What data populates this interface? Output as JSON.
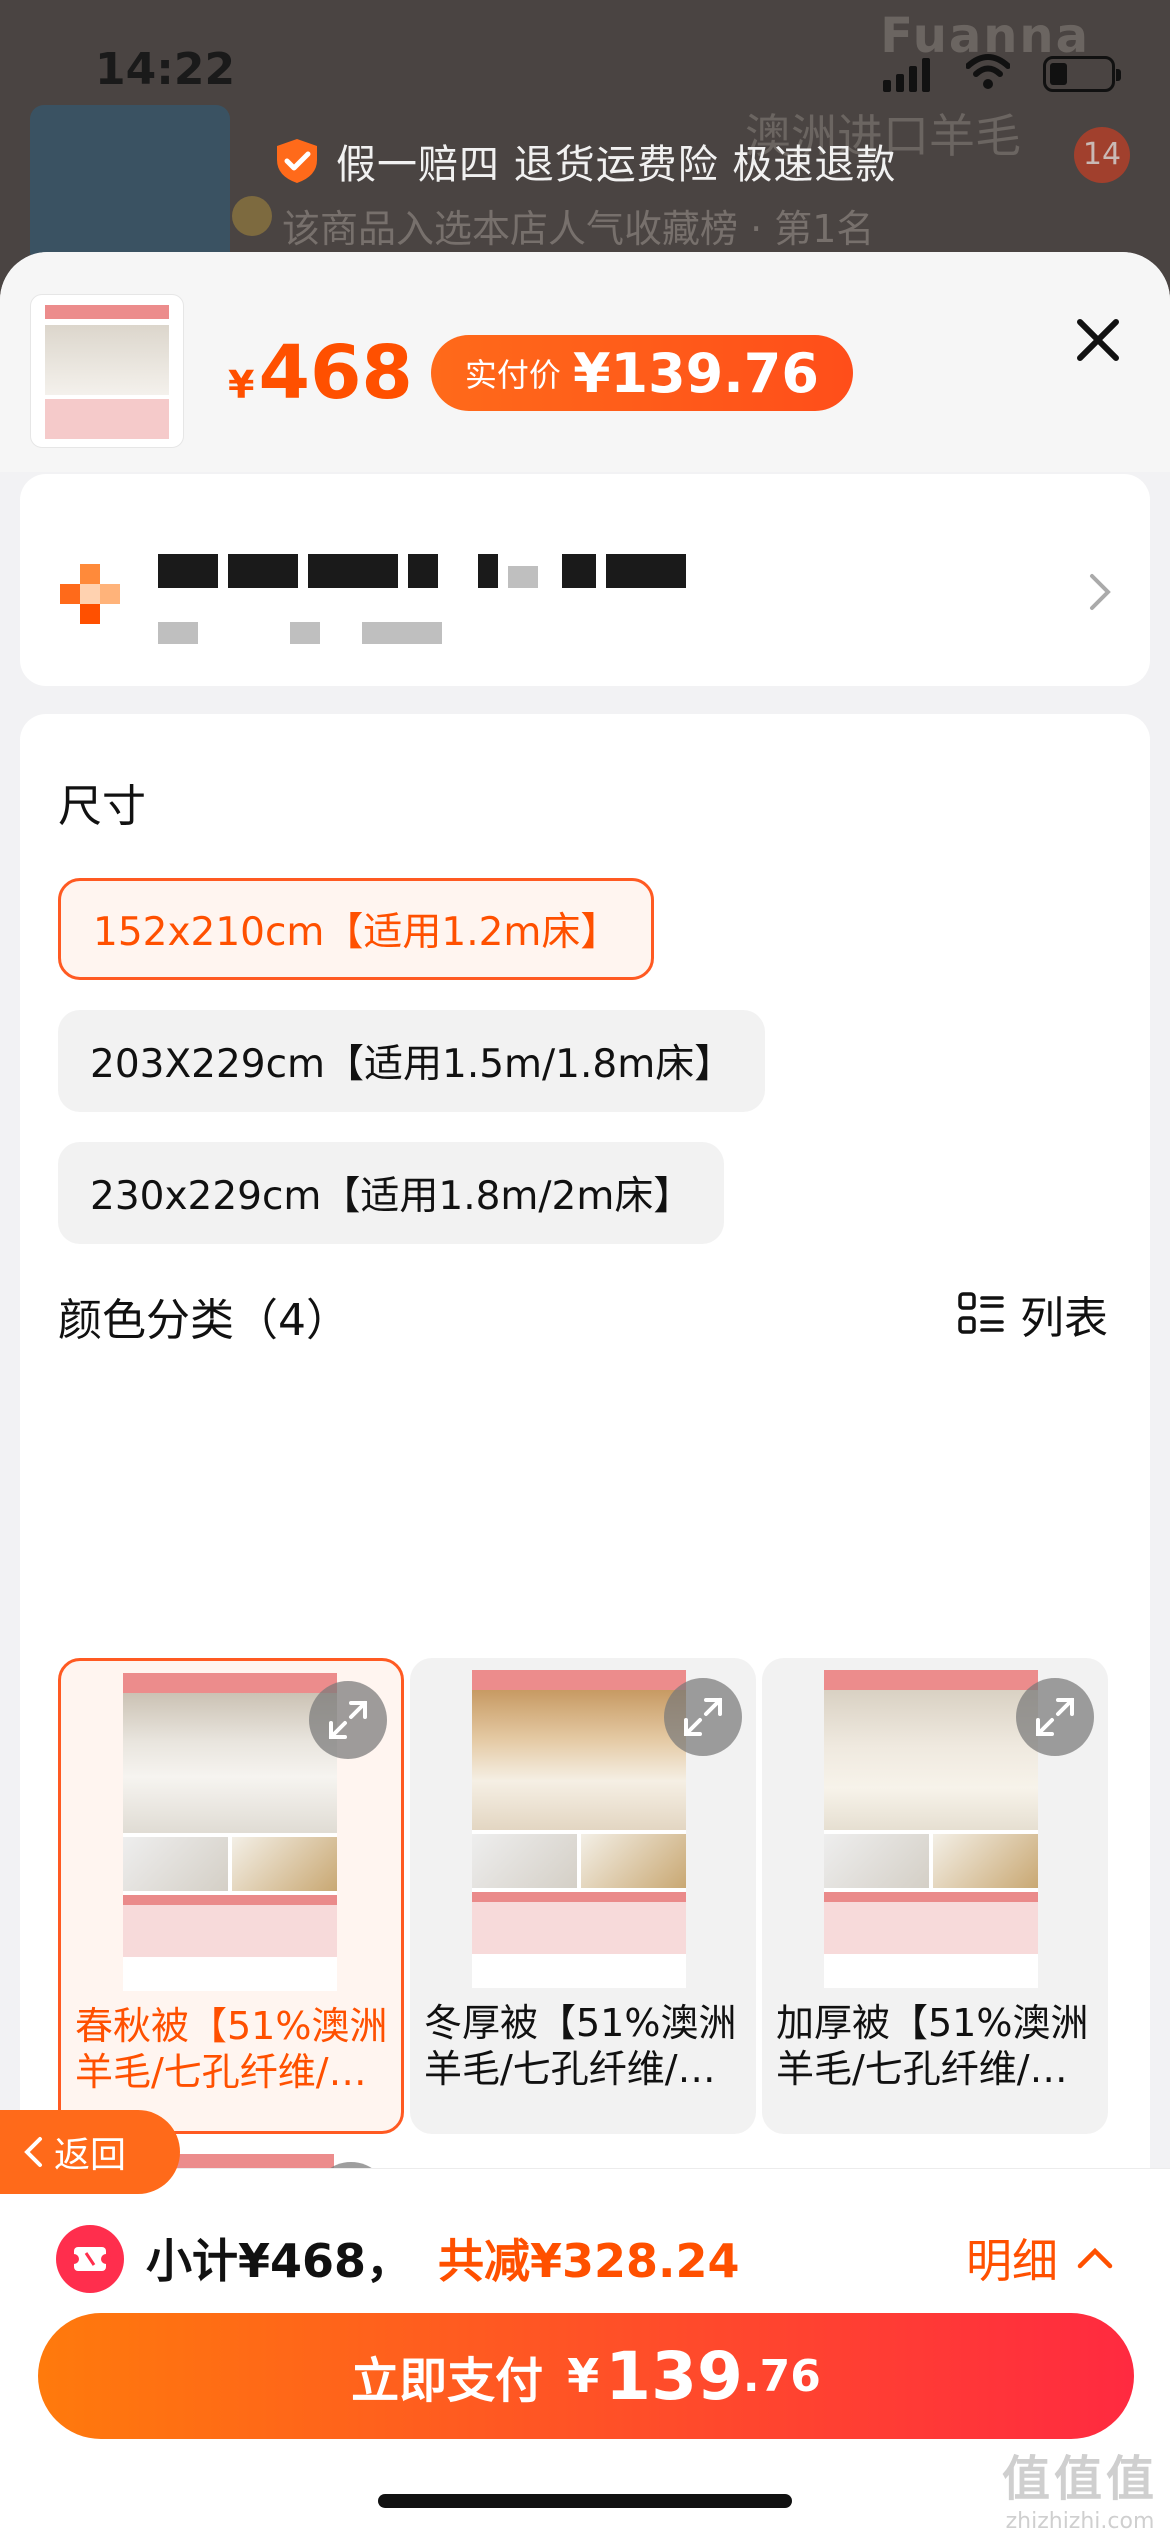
{
  "status_bar": {
    "time": "14:22"
  },
  "background_page": {
    "brand": "Fuanna",
    "title": "澳洲进口羊毛",
    "rank_text": "该商品入选本店人气收藏榜 · 第1名",
    "cart_count": "14"
  },
  "guarantee": {
    "text": "假一赔四 退货运费险 极速退款"
  },
  "sheet": {
    "price": {
      "currency": "¥",
      "original": "468",
      "paid_label": "实付价",
      "paid_value": "¥139.76"
    },
    "size": {
      "title": "尺寸",
      "options": [
        {
          "label": "152x210cm【适用1.2m床】",
          "selected": true
        },
        {
          "label": "203X229cm【适用1.5m/1.8m床】",
          "selected": false
        },
        {
          "label": "230x229cm【适用1.8m/2m床】",
          "selected": false
        }
      ]
    },
    "color": {
      "title": "颜色分类（4）",
      "list_toggle": "列表",
      "options": [
        {
          "name": "春秋被【51%澳洲羊毛/七孔纤维/…",
          "selected": true
        },
        {
          "name": "冬厚被【51%澳洲羊毛/七孔纤维/…",
          "selected": false
        },
        {
          "name": "加厚被【51%澳洲羊毛/七孔纤维/…",
          "selected": false
        },
        {
          "name": "",
          "selected": false
        }
      ]
    }
  },
  "back_button": {
    "label": "返回"
  },
  "footer": {
    "subtotal": "小计¥468，",
    "discount": "共减¥328.24",
    "detail": "明细",
    "pay_label": "立即支付",
    "pay_symbol": "¥",
    "pay_int": "139",
    "pay_dec": ".76"
  },
  "watermark": {
    "line1": "值值值",
    "line2": "zhizhizhi.com"
  },
  "colors": {
    "accent": "#ff5000",
    "pay_gradient_start": "#ff7a0c",
    "pay_gradient_end": "#ff2a40"
  }
}
